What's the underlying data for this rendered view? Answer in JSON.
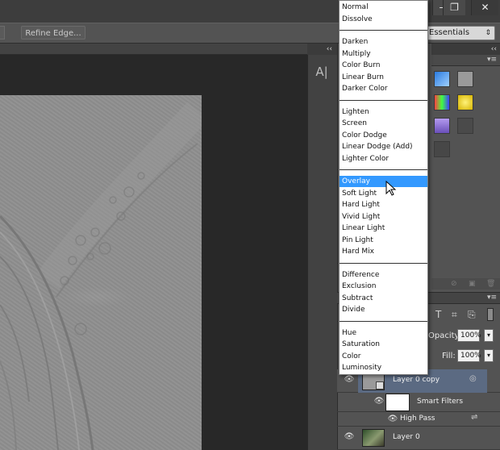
{
  "window_controls": {
    "minimize": "—",
    "restore": "❐",
    "close": "✕"
  },
  "options_bar": {
    "refine_edge_label": "Refine Edge...",
    "workspace_value": "Essentials"
  },
  "collapse_arrows": "‹‹",
  "tool_char": "A|",
  "blend_menu": {
    "selected": "Overlay",
    "groups": [
      [
        "Normal",
        "Dissolve"
      ],
      [
        "Darken",
        "Multiply",
        "Color Burn",
        "Linear Burn",
        "Darker Color"
      ],
      [
        "Lighten",
        "Screen",
        "Color Dodge",
        "Linear Dodge (Add)",
        "Lighter Color"
      ],
      [
        "Overlay",
        "Soft Light",
        "Hard Light",
        "Vivid Light",
        "Linear Light",
        "Pin Light",
        "Hard Mix"
      ],
      [
        "Difference",
        "Exclusion",
        "Subtract",
        "Divide"
      ],
      [
        "Hue",
        "Saturation",
        "Color",
        "Luminosity"
      ]
    ]
  },
  "layers_panel": {
    "opacity_label": "Opacity:",
    "opacity_value": "100%",
    "fill_label": "Fill:",
    "fill_value": "100%",
    "layers": [
      {
        "name": "Layer 0 copy",
        "selected": true
      },
      {
        "name": "Smart Filters"
      },
      {
        "name": "High Pass"
      },
      {
        "name": "Layer 0"
      }
    ]
  },
  "colors": {
    "menu_highlight": "#3399ff",
    "panel_bg": "#535353",
    "canvas_bg": "#282828"
  }
}
